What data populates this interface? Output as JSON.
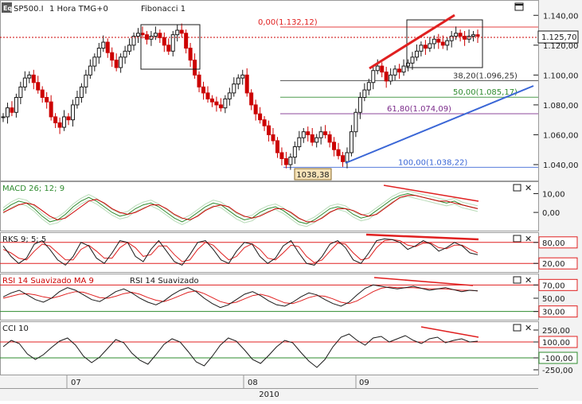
{
  "header": {
    "symbol": "SP500.I",
    "timeframe": "1 Hora TMG+0",
    "study": "Fibonacci 1",
    "menu_icon": "triangle-down-icon",
    "window_icon": "maximize-icon"
  },
  "colors": {
    "up_candle": "#1a1a1a",
    "down_candle": "#cc0000",
    "red": "#e02020",
    "blue": "#3a66d6",
    "green": "#2e8b2e",
    "purple": "#7a2a8a",
    "grid": "#cfcfcf"
  },
  "chart_data": [
    {
      "type": "candlestick",
      "panel": "price",
      "title": "SP500.I 1 Hora TMG+0",
      "yticks": [
        "1.140,00",
        "1.120,00",
        "1.100,00",
        "1.080,00",
        "1.060,00",
        "1.040,00"
      ],
      "ylim": [
        1032,
        1146
      ],
      "current_price": "1.125,70",
      "low_label": "1038,38",
      "fib_levels": [
        {
          "label": "0,00(1.132,12)",
          "value": 1132.12,
          "color": "#e02020"
        },
        {
          "label": "38,20(1.096,25)",
          "value": 1096.25,
          "color": "#333333"
        },
        {
          "label": "50,00(1.085,17)",
          "value": 1085.17,
          "color": "#2e8b2e"
        },
        {
          "label": "61,80(1.074,09)",
          "value": 1074.09,
          "color": "#7a2a8a"
        },
        {
          "label": "100,00(1.038,22)",
          "value": 1038.22,
          "color": "#3a66d6"
        }
      ],
      "close_path": [
        1072,
        1078,
        1075,
        1085,
        1092,
        1098,
        1100,
        1095,
        1090,
        1085,
        1082,
        1072,
        1068,
        1065,
        1072,
        1070,
        1080,
        1085,
        1092,
        1100,
        1106,
        1112,
        1118,
        1122,
        1115,
        1110,
        1105,
        1112,
        1116,
        1120,
        1126,
        1128,
        1127,
        1124,
        1126,
        1128,
        1125,
        1120,
        1116,
        1127,
        1130,
        1128,
        1118,
        1110,
        1100,
        1092,
        1088,
        1084,
        1082,
        1080,
        1078,
        1084,
        1088,
        1094,
        1098,
        1100,
        1088,
        1080,
        1074,
        1070,
        1066,
        1060,
        1056,
        1048,
        1044,
        1040,
        1045,
        1052,
        1058,
        1062,
        1060,
        1055,
        1058,
        1062,
        1060,
        1055,
        1050,
        1046,
        1042,
        1048,
        1062,
        1075,
        1085,
        1090,
        1095,
        1103,
        1106,
        1102,
        1096,
        1100,
        1104,
        1102,
        1106,
        1108,
        1112,
        1116,
        1120,
        1118,
        1121,
        1124,
        1122,
        1120,
        1123,
        1126,
        1128,
        1126,
        1124,
        1126,
        1127,
        1126
      ],
      "x_labels": [
        "07",
        "08",
        "09"
      ],
      "x_year": "2010"
    },
    {
      "type": "line",
      "panel": "macd",
      "series": [
        {
          "name": "MACD 26; 12; 9",
          "color": "#2e8b2e"
        },
        {
          "name": "MACD 26; 12; 9 signal",
          "color": "#cc0000"
        }
      ],
      "yticks": [
        "10,00",
        "0,00"
      ],
      "ylim": [
        -8,
        14
      ],
      "macd_line": [
        1,
        4,
        6,
        5,
        2,
        -2,
        -5,
        -4,
        -1,
        3,
        6,
        8,
        6,
        3,
        0,
        -2,
        -1,
        2,
        4,
        5,
        3,
        0,
        -3,
        -5,
        -3,
        0,
        3,
        5,
        4,
        1,
        -2,
        -4,
        -3,
        0,
        2,
        3,
        1,
        -2,
        -5,
        -6,
        -4,
        -1,
        2,
        3,
        2,
        -1,
        -3,
        -2,
        1,
        4,
        7,
        9,
        10,
        9,
        8,
        7,
        6,
        5,
        6,
        4,
        3,
        2
      ],
      "signal_line": [
        0,
        2,
        4,
        5,
        4,
        1,
        -2,
        -4,
        -3,
        0,
        3,
        6,
        7,
        5,
        2,
        0,
        -1,
        0,
        2,
        4,
        4,
        2,
        -1,
        -3,
        -4,
        -2,
        1,
        3,
        4,
        3,
        0,
        -2,
        -3,
        -2,
        0,
        2,
        2,
        0,
        -3,
        -5,
        -5,
        -3,
        0,
        2,
        2,
        1,
        -1,
        -2,
        -1,
        2,
        5,
        8,
        9,
        9,
        8,
        7,
        6,
        6,
        5,
        4,
        3,
        2
      ]
    },
    {
      "type": "line",
      "panel": "stochastic",
      "series": [
        {
          "name": "RKS 9; 5; 5",
          "color": "#cc0000"
        }
      ],
      "yticks": [
        "80,00",
        "20,00"
      ],
      "ylim": [
        0,
        100
      ],
      "k_line": [
        70,
        40,
        20,
        35,
        75,
        85,
        60,
        30,
        15,
        40,
        80,
        70,
        35,
        20,
        50,
        85,
        80,
        40,
        25,
        60,
        85,
        55,
        25,
        15,
        45,
        80,
        85,
        60,
        30,
        20,
        55,
        80,
        75,
        40,
        20,
        35,
        70,
        85,
        50,
        20,
        15,
        40,
        75,
        85,
        65,
        30,
        20,
        50,
        85,
        90,
        88,
        80,
        60,
        70,
        85,
        75,
        55,
        65,
        80,
        70,
        50,
        45
      ],
      "d_line": [
        60,
        50,
        35,
        30,
        55,
        75,
        70,
        50,
        30,
        30,
        60,
        72,
        55,
        35,
        35,
        65,
        80,
        65,
        40,
        45,
        70,
        70,
        45,
        25,
        30,
        60,
        80,
        72,
        50,
        30,
        40,
        65,
        76,
        60,
        35,
        30,
        50,
        72,
        68,
        40,
        22,
        30,
        55,
        78,
        75,
        50,
        30,
        35,
        65,
        85,
        88,
        85,
        72,
        68,
        78,
        78,
        65,
        62,
        72,
        72,
        60,
        50
      ]
    },
    {
      "type": "line",
      "panel": "rsi",
      "series": [
        {
          "name": "RSI 14 Suavizado MA 9",
          "color": "#cc0000"
        },
        {
          "name": "RSI 14 Suavizado",
          "color": "#1a1a1a"
        }
      ],
      "yticks": [
        "70,00",
        "50,00",
        "30,00"
      ],
      "ylim": [
        20,
        80
      ],
      "rsi_line": [
        52,
        58,
        62,
        55,
        48,
        44,
        50,
        60,
        66,
        62,
        55,
        48,
        45,
        52,
        60,
        64,
        58,
        50,
        44,
        40,
        46,
        55,
        62,
        66,
        60,
        50,
        42,
        36,
        40,
        48,
        56,
        60,
        54,
        46,
        40,
        38,
        44,
        52,
        58,
        55,
        48,
        42,
        38,
        44,
        55,
        65,
        70,
        68,
        66,
        64,
        66,
        68,
        65,
        62,
        64,
        66,
        63,
        60,
        62,
        61
      ],
      "rsi_ma": [
        50,
        53,
        56,
        57,
        55,
        52,
        50,
        53,
        57,
        60,
        59,
        55,
        51,
        50,
        53,
        57,
        59,
        56,
        51,
        47,
        45,
        49,
        54,
        59,
        61,
        57,
        51,
        45,
        42,
        44,
        49,
        54,
        56,
        53,
        48,
        43,
        42,
        46,
        51,
        54,
        53,
        49,
        44,
        42,
        46,
        53,
        60,
        65,
        67,
        66,
        66,
        66,
        65,
        64,
        64,
        64,
        63,
        62,
        62,
        61
      ]
    },
    {
      "type": "line",
      "panel": "cci",
      "series": [
        {
          "name": "CCI 10",
          "color": "#1a1a1a"
        }
      ],
      "yticks": [
        "250,00",
        "100,00",
        "-100,00",
        "-250,00"
      ],
      "ylim": [
        -300,
        300
      ],
      "cci_line": [
        40,
        120,
        80,
        -50,
        -120,
        -60,
        30,
        110,
        150,
        60,
        -80,
        -160,
        -90,
        20,
        130,
        90,
        -40,
        -130,
        -180,
        -60,
        70,
        140,
        100,
        -20,
        -150,
        -200,
        -80,
        60,
        150,
        110,
        0,
        -120,
        -170,
        -70,
        40,
        120,
        90,
        -30,
        -140,
        -220,
        -120,
        40,
        160,
        200,
        120,
        60,
        150,
        170,
        100,
        140,
        180,
        120,
        80,
        140,
        160,
        90,
        120,
        140,
        100,
        110
      ]
    }
  ]
}
